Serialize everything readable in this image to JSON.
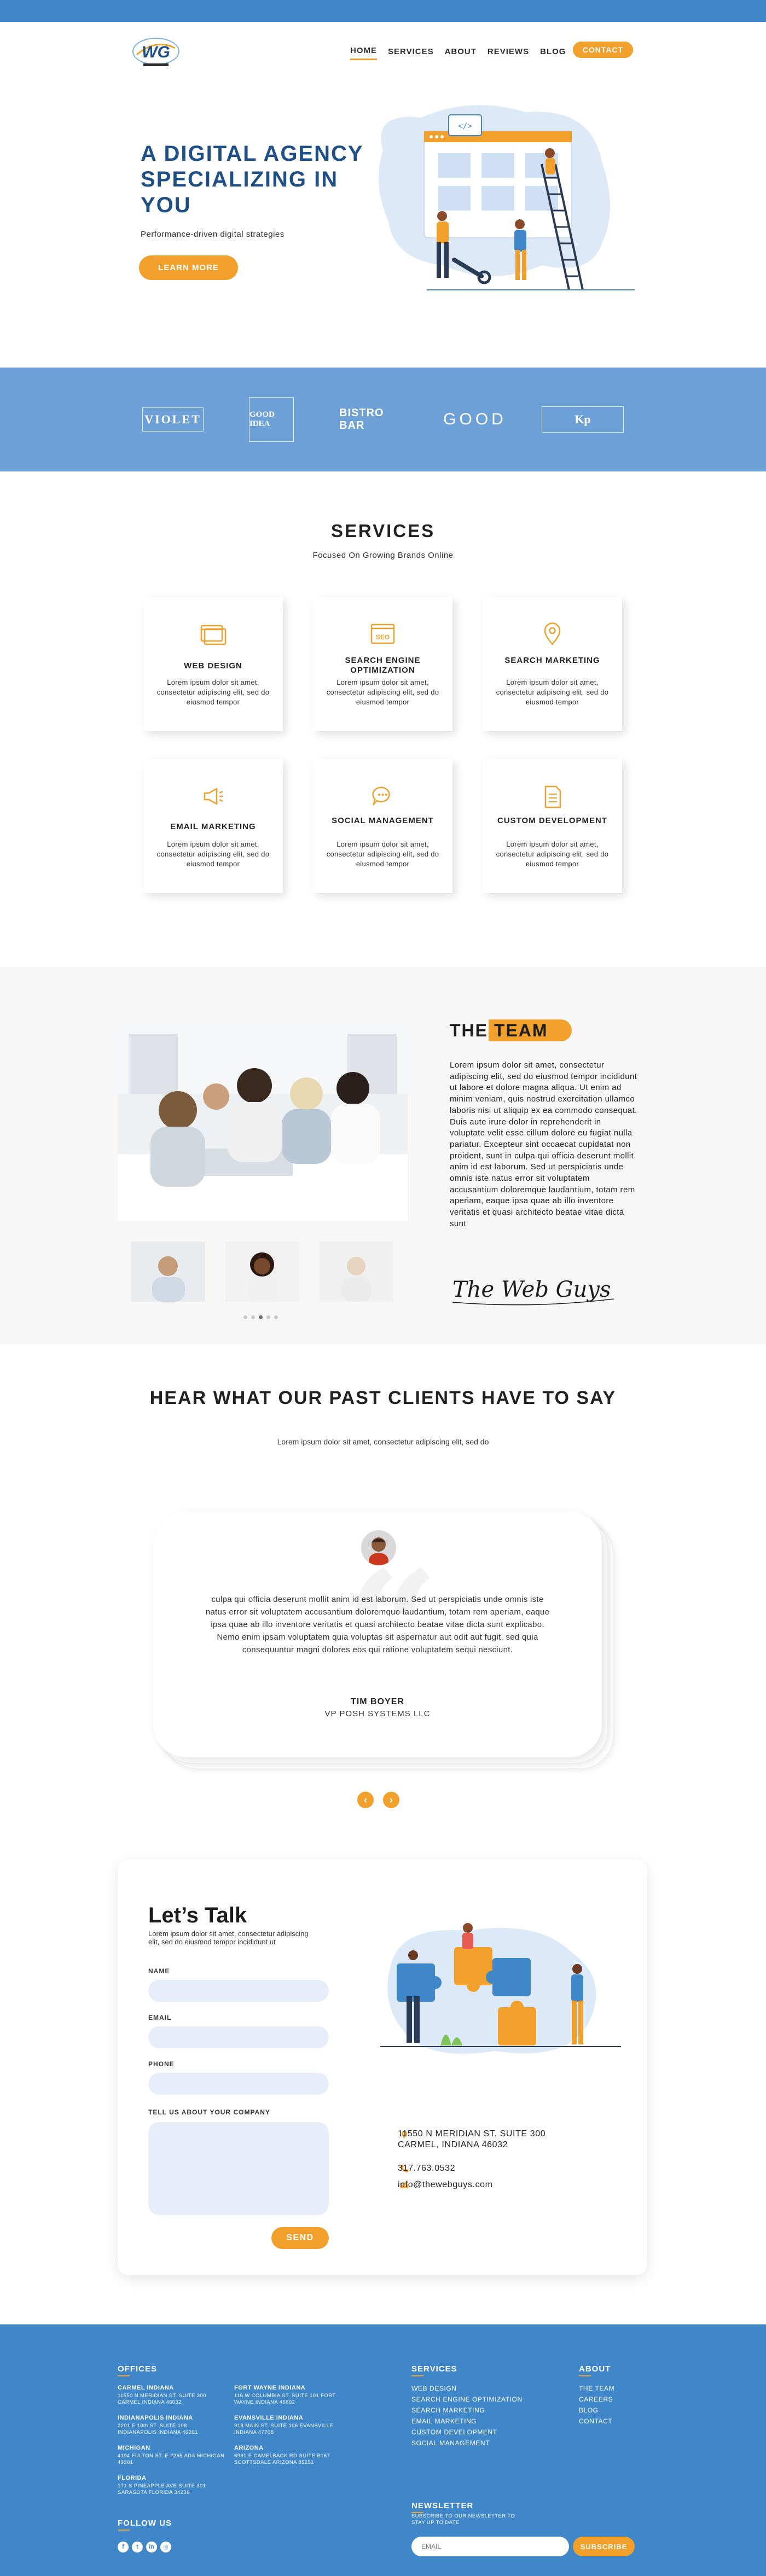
{
  "brand": {
    "logo_text": "WG"
  },
  "nav": {
    "items": [
      "HOME",
      "SERVICES",
      "ABOUT",
      "REVIEWS",
      "BLOG"
    ],
    "contact": "CONTACT"
  },
  "hero": {
    "title": "A DIGITAL AGENCY SPECIALIZING IN YOU",
    "subtitle": "Performance-driven digital strategies",
    "cta": "LEARN MORE"
  },
  "clients": {
    "logos": [
      "VIOLET",
      "GOOD IDEA",
      "BISTRO BAR",
      "GOOD",
      "Kp"
    ]
  },
  "services": {
    "title": "SERVICES",
    "subtitle": "Focused On Growing Brands Online",
    "items": [
      {
        "name": "WEB DESIGN",
        "desc": "Lorem ipsum dolor sit amet, consectetur adipiscing elit, sed do eiusmod tempor",
        "icon": "browser-icon"
      },
      {
        "name": "SEARCH ENGINE OPTIMIZATION",
        "desc": "Lorem ipsum dolor sit amet, consectetur adipiscing elit, sed do eiusmod tempor",
        "icon": "seo-icon"
      },
      {
        "name": "SEARCH MARKETING",
        "desc": "Lorem ipsum dolor sit amet, consectetur adipiscing elit, sed do eiusmod tempor",
        "icon": "location-pin-icon"
      },
      {
        "name": "EMAIL MARKETING",
        "desc": "Lorem ipsum dolor sit amet, consectetur adipiscing elit, sed do eiusmod tempor",
        "icon": "megaphone-icon"
      },
      {
        "name": "SOCIAL MANAGEMENT",
        "desc": "Lorem ipsum dolor sit amet, consectetur adipiscing elit, sed do eiusmod tempor",
        "icon": "chat-icon"
      },
      {
        "name": "CUSTOM DEVELOPMENT",
        "desc": "Lorem ipsum dolor sit amet, consectetur adipiscing elit, sed do eiusmod tempor",
        "icon": "document-icon"
      }
    ]
  },
  "team": {
    "title_a": "THE",
    "title_b": "TEAM",
    "body": "Lorem ipsum dolor sit amet, consectetur adipiscing elit, sed do eiusmod tempor incididunt ut labore et dolore magna aliqua. Ut enim ad minim veniam, quis nostrud exercitation ullamco laboris nisi ut aliquip ex ea commodo consequat. Duis aute irure dolor in reprehenderit in voluptate velit esse cillum dolore eu fugiat nulla pariatur. Excepteur sint occaecat cupidatat non proident, sunt in culpa qui officia deserunt mollit anim id est laborum. Sed ut perspiciatis unde omnis iste natus error sit voluptatem accusantium doloremque laudantium, totam rem aperiam, eaque ipsa quae ab illo inventore veritatis et quasi architecto beatae vitae dicta sunt",
    "signature": "The Web Guys"
  },
  "testimonials": {
    "title": "HEAR WHAT OUR PAST CLIENTS HAVE TO SAY",
    "subtitle": "Lorem ipsum dolor sit amet, consectetur adipiscing elit, sed do",
    "quote": "culpa qui officia deserunt mollit anim id est laborum. Sed ut perspiciatis unde omnis iste natus error sit voluptatem accusantium doloremque laudantium, totam rem aperiam, eaque ipsa quae ab illo inventore veritatis et quasi architecto beatae vitae dicta sunt explicabo. Nemo enim ipsam voluptatem quia voluptas sit aspernatur aut odit aut fugit, sed quia consequuntur magni dolores eos qui ratione voluptatem sequi nesciunt.",
    "name": "TIM BOYER",
    "role": "VP POSH SYSTEMS LLC"
  },
  "contact": {
    "title": "Let’s Talk",
    "subtitle": "Lorem ipsum dolor sit amet, consectetur adipiscing elit, sed do eiusmod tempor incididunt ut",
    "labels": {
      "name": "NAME",
      "email": "EMAIL",
      "phone": "PHONE",
      "company": "TELL US ABOUT YOUR COMPANY"
    },
    "send": "SEND",
    "address_1": "11550 N MERIDIAN ST. SUITE 300",
    "address_2": "CARMEL, INDIANA 46032",
    "phone": "317.763.0532",
    "email": "info@thewebguys.com"
  },
  "footer": {
    "offices_title": "OFFICES",
    "offices": [
      {
        "city": "CARMEL INDIANA",
        "addr": "11550 N MERIDIAN ST. SUITE 300 CARMEL INDIANA 46032"
      },
      {
        "city": "INDIANAPOLIS INDIANA",
        "addr": "3201 E 10th ST. SUITE 108 INDIANAPOLIS INDIANA 46201"
      },
      {
        "city": "MICHIGAN",
        "addr": "4194 FULTON ST. E #265 ADA MICHIGAN 49301"
      },
      {
        "city": "FLORIDA",
        "addr": "171 S PINEAPPLE AVE SUITE 301 SARASOTA FLORIDA 34236"
      },
      {
        "city": "FORT WAYNE INDIANA",
        "addr": "116 W COLUMBIA ST. SUITE 101 FORT WAYNE INDIANA 46802"
      },
      {
        "city": "EVANSVILLE INDIANA",
        "addr": "918 MAIN ST. SUITE 106 EVANSVILLE INDIANA 47708"
      },
      {
        "city": "ARIZONA",
        "addr": "6991 E CAMELBACK RD SUITE B167 SCOTTSDALE ARIZONA 85251"
      }
    ],
    "services_title": "SERVICES",
    "services": [
      "WEB DESIGN",
      "SEARCH ENGINE OPTIMIZATION",
      "SEARCH MARKETING",
      "EMAIL MARKETING",
      "CUSTOM DEVELOPMENT",
      "SOCIAL MANAGEMENT"
    ],
    "about_title": "ABOUT",
    "about": [
      "THE TEAM",
      "CAREERS",
      "BLOG",
      "CONTACT"
    ],
    "follow": "FOLLOW US",
    "newsletter_title": "NEWSLETTER",
    "newsletter_sub": "SUBSCRIBE TO OUR NEWSLETTER TO STAY UP TO DATE",
    "email_placeholder": "EMAIL",
    "subscribe": "SUBSCRIBE"
  }
}
